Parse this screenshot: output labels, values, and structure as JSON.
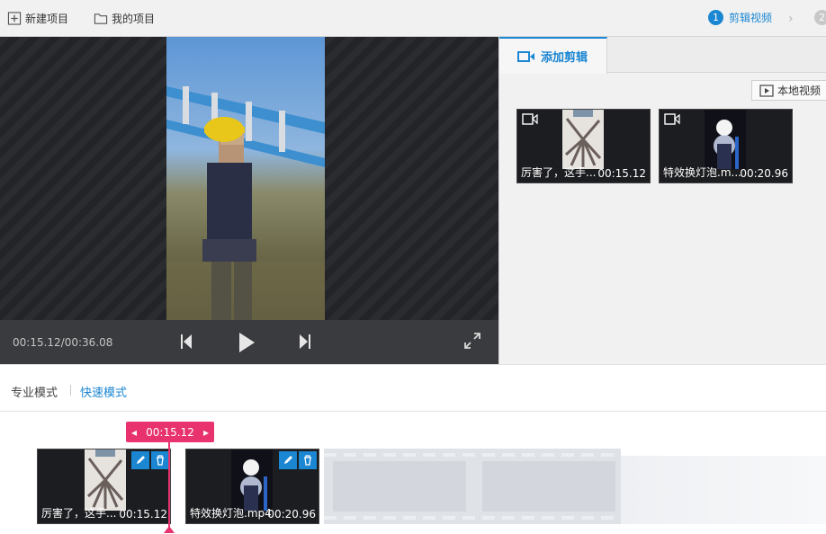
{
  "toolbar": {
    "new_project": "新建项目",
    "my_projects": "我的项目"
  },
  "steps": [
    {
      "number": "1",
      "label": "剪辑视频",
      "active": true
    },
    {
      "number": "2",
      "label": "",
      "active": false
    }
  ],
  "player": {
    "time": "00:15.12/00:36.08"
  },
  "right_panel": {
    "tab_label": "添加剪辑",
    "local_video_button": "本地视频",
    "clips": [
      {
        "name": "厉害了，这手...",
        "duration": "00:15.12"
      },
      {
        "name": "特效换灯泡.m...",
        "duration": "00:20.96"
      }
    ]
  },
  "modes": {
    "pro": "专业模式",
    "fast": "快速模式"
  },
  "timeline": {
    "playhead_time": "00:15.12",
    "clips": [
      {
        "name": "厉害了，这手...",
        "duration": "00:15.12"
      },
      {
        "name": "特效换灯泡.mp4",
        "duration": "00:20.96"
      }
    ]
  },
  "colors": {
    "accent": "#1b86d2",
    "playhead": "#e8336e"
  }
}
